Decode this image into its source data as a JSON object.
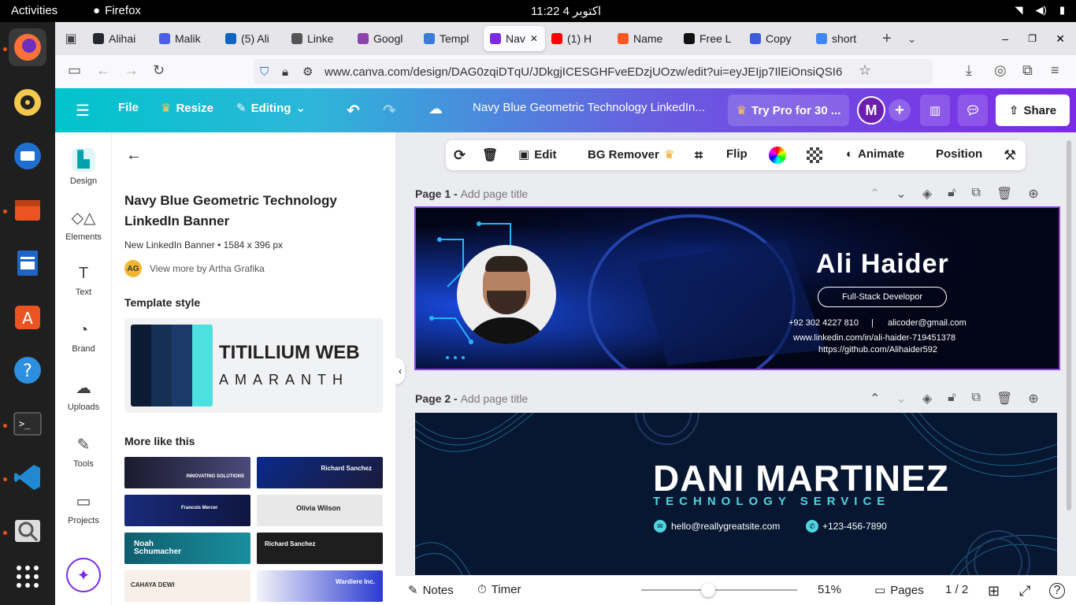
{
  "system": {
    "activities": "Activities",
    "app_name": "Firefox",
    "clock": "11:22  4 اکتوبر"
  },
  "browser": {
    "tabs": [
      {
        "label": "Alihai",
        "color": "#24292f"
      },
      {
        "label": "Malik",
        "color": "#4a5ee8"
      },
      {
        "label": "(5) Ali",
        "color": "#0a66c2"
      },
      {
        "label": "Linke",
        "color": "#555555"
      },
      {
        "label": "Googl",
        "color": "#8e44ad"
      },
      {
        "label": "Templ",
        "color": "#3a7bd5"
      },
      {
        "label": "Nav",
        "color": "#7d2ae8"
      },
      {
        "label": "(1) H",
        "color": "#ff0000"
      },
      {
        "label": "Name",
        "color": "#ff5722"
      },
      {
        "label": "Free L",
        "color": "#111111"
      },
      {
        "label": "Copy",
        "color": "#3b5bdb"
      },
      {
        "label": "short",
        "color": "#4285f4"
      }
    ],
    "url": "www.canva.com/design/DAG0zqiDTqU/JDkgjICESGHFveEDzjUOzw/edit?ui=eyJEIjp7IlEiOnsiQSI6"
  },
  "canva_header": {
    "file": "File",
    "resize": "Resize",
    "editing": "Editing",
    "doc_title": "Navy Blue Geometric Technology LinkedIn...",
    "try_pro": "Try Pro for 30 ...",
    "avatar": "M",
    "share": "Share"
  },
  "rail": {
    "items": [
      {
        "label": "Design",
        "icon": "design-icon"
      },
      {
        "label": "Elements",
        "icon": "elements-icon"
      },
      {
        "label": "Text",
        "icon": "text-icon"
      },
      {
        "label": "Brand",
        "icon": "brand-icon"
      },
      {
        "label": "Uploads",
        "icon": "uploads-icon"
      },
      {
        "label": "Tools",
        "icon": "tools-icon"
      },
      {
        "label": "Projects",
        "icon": "projects-icon"
      }
    ]
  },
  "panel": {
    "title": "Navy Blue Geometric Technology LinkedIn Banner",
    "meta": "New LinkedIn Banner • 1584 x 396 px",
    "author_initials": "AG",
    "author": "View more by Artha Grafika",
    "template_style": "Template style",
    "font_primary": "TITILLIUM WEB",
    "font_secondary": "AMARANTH",
    "more_like": "More like this",
    "thumbs": [
      {
        "text": "INNOVATING SOLUTIONS"
      },
      {
        "text": "Richard Sanchez"
      },
      {
        "text": "Francois Mercer"
      },
      {
        "text": "Olivia Wilson"
      },
      {
        "text": "Noah Schumacher"
      },
      {
        "text": "Richard Sanchez"
      },
      {
        "text": "CAHAYA DEWI"
      },
      {
        "text": "Wardiere Inc."
      }
    ]
  },
  "toolbar": {
    "edit": "Edit",
    "bg_remover": "BG Remover",
    "flip": "Flip",
    "animate": "Animate",
    "position": "Position"
  },
  "page1": {
    "label": "Page 1 -",
    "add_title": "Add page title",
    "name": "Ali Haider",
    "role": "Full-Stack Developor",
    "phone": "+92 302 4227 810",
    "separator": "|",
    "email": "alicoder@gmail.com",
    "linkedin": "www.linkedin.com/in/ali-haider-719451378",
    "github": "https://github.com/Alihaider592"
  },
  "page2": {
    "label": "Page 2 -",
    "add_title": "Add page title",
    "name": "DANI MARTINEZ",
    "subtitle": "TECHNOLOGY SERVICE",
    "email": "hello@reallygreatsite.com",
    "phone": "+123-456-7890"
  },
  "footer": {
    "notes": "Notes",
    "timer": "Timer",
    "zoom": "51%",
    "pages": "Pages",
    "page_count": "1 / 2",
    "zoom_level": 0.43
  }
}
